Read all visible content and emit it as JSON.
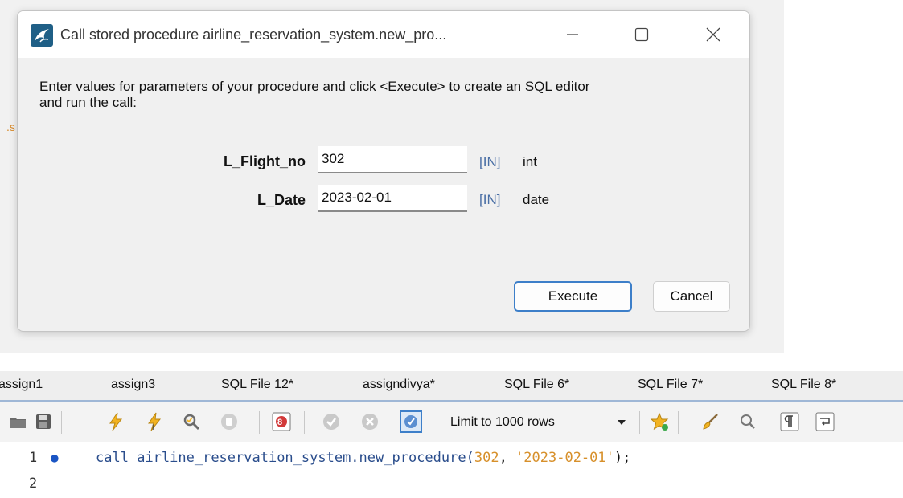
{
  "background": {
    "fragment_text": ".s"
  },
  "dialog": {
    "title": "Call stored procedure airline_reservation_system.new_pro...",
    "intro_line1": "Enter values for parameters of your procedure and click <Execute> to create an SQL editor",
    "intro_line2": "and run the call:",
    "params": [
      {
        "label": "L_Flight_no",
        "value": "302",
        "direction": "[IN]",
        "type": "int"
      },
      {
        "label": "L_Date",
        "value": "2023-02-01",
        "direction": "[IN]",
        "type": "date"
      }
    ],
    "execute_label": "Execute",
    "cancel_label": "Cancel"
  },
  "tabs": [
    "assign1",
    "assign3",
    "SQL File 12*",
    "assigndivya*",
    "SQL File 6*",
    "SQL File 7*",
    "SQL File 8*"
  ],
  "toolbar": {
    "icons": [
      "open-folder-icon",
      "save-icon",
      "execute-lightning-icon",
      "execute-current-icon",
      "explain-icon",
      "stop-icon",
      "toggle-errors-icon",
      "commit-icon",
      "rollback-icon",
      "autocommit-icon",
      "favorite-icon",
      "beautify-icon",
      "find-icon",
      "invisible-chars-icon",
      "wrap-icon"
    ],
    "limit_label": "Limit to 1000 rows"
  },
  "editor": {
    "lines": [
      {
        "number": "1",
        "marker": "●",
        "keyword": "call",
        "object": "airline_reservation_system.new_procedure(",
        "arg1": "302",
        "sep": ", ",
        "arg2": "'2023-02-01'",
        "end": ");"
      },
      {
        "number": "2"
      }
    ]
  },
  "colors": {
    "accent": "#3d7fc9",
    "keyword": "#2a4d8c",
    "literal": "#d7902b",
    "param_direction": "#4a6fa5"
  }
}
